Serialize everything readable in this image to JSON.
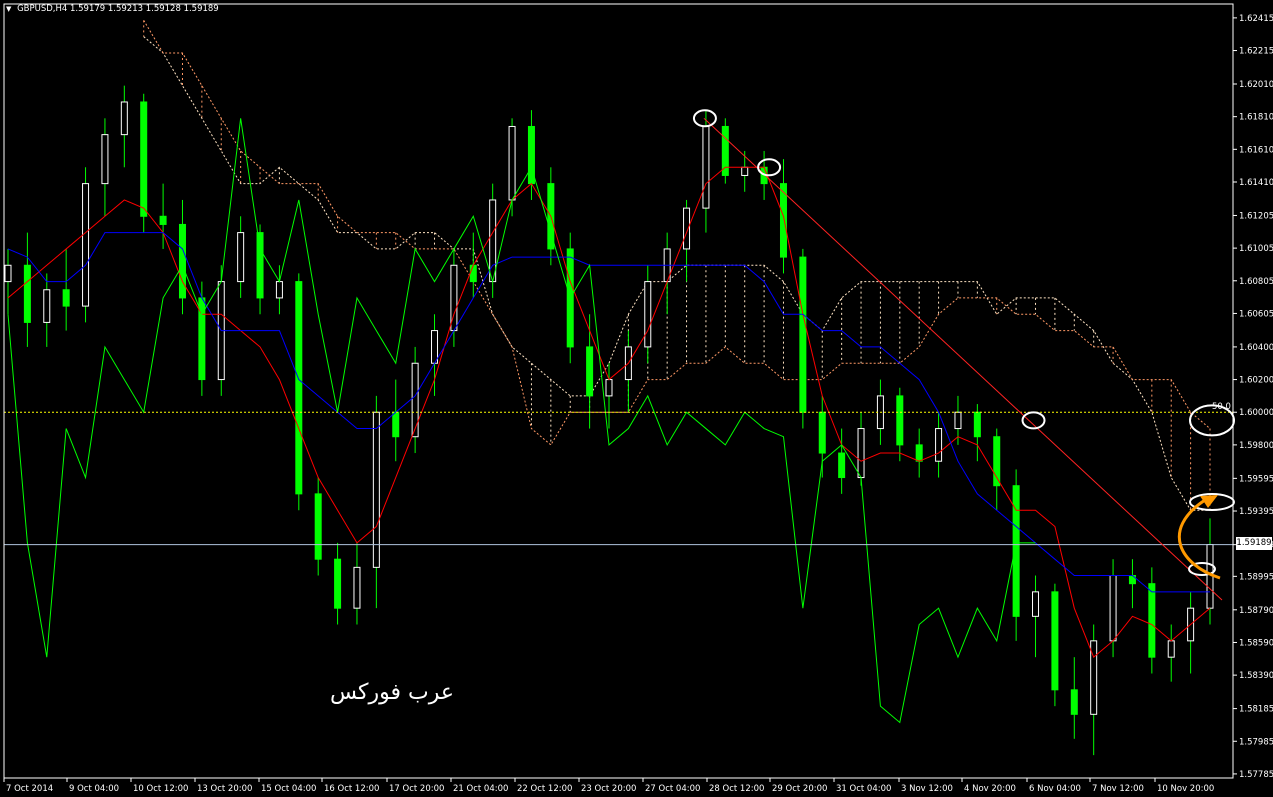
{
  "header": {
    "symbol": "GBPUSD,H4",
    "ohlc": "1.59179 1.59213 1.59128 1.59189"
  },
  "watermark": "عرب فوركس",
  "colors": {
    "background": "#000000",
    "bull_candle": "#ffffff",
    "bear_candle": "#00ff00",
    "tenkan": "#ff0000",
    "kijun": "#0000ff",
    "chikou": "#00ff00",
    "cloud_a": "#ffe4c4",
    "cloud_b": "#ff9966",
    "trendline": "#ff2222",
    "level_line": "#ffff00",
    "bid_line": "#b0c4de",
    "projection": "#ff9900"
  },
  "chart_data": {
    "type": "candlestick",
    "title": "GBPUSD,H4",
    "ylim": [
      1.5776,
      1.625
    ],
    "y_ticks": [
      "1.62415",
      "1.62215",
      "1.62010",
      "1.61810",
      "1.61610",
      "1.61410",
      "1.61205",
      "1.61005",
      "1.60805",
      "1.60605",
      "1.60400",
      "1.60200",
      "1.60000",
      "1.59800",
      "1.59595",
      "1.59395",
      "1.59189",
      "1.58995",
      "1.58790",
      "1.58590",
      "1.58390",
      "1.58185",
      "1.57985",
      "1.57785"
    ],
    "x_ticks": [
      "7 Oct 2014",
      "9 Oct 04:00",
      "10 Oct 12:00",
      "13 Oct 20:00",
      "15 Oct 04:00",
      "16 Oct 12:00",
      "17 Oct 20:00",
      "21 Oct 04:00",
      "22 Oct 12:00",
      "23 Oct 20:00",
      "27 Oct 04:00",
      "28 Oct 12:00",
      "29 Oct 20:00",
      "31 Oct 04:00",
      "3 Nov 12:00",
      "4 Nov 20:00",
      "6 Nov 04:00",
      "7 Nov 12:00",
      "10 Nov 20:00"
    ],
    "current_price": "1.59189",
    "level_line": 1.6,
    "level_label": "50.0",
    "candles": [
      {
        "o": 1.608,
        "h": 1.61,
        "l": 1.606,
        "c": 1.609
      },
      {
        "o": 1.609,
        "h": 1.611,
        "l": 1.604,
        "c": 1.6055
      },
      {
        "o": 1.6055,
        "h": 1.6085,
        "l": 1.604,
        "c": 1.6075
      },
      {
        "o": 1.6075,
        "h": 1.61,
        "l": 1.605,
        "c": 1.6065
      },
      {
        "o": 1.6065,
        "h": 1.615,
        "l": 1.6055,
        "c": 1.614
      },
      {
        "o": 1.614,
        "h": 1.618,
        "l": 1.612,
        "c": 1.617
      },
      {
        "o": 1.617,
        "h": 1.62,
        "l": 1.615,
        "c": 1.619
      },
      {
        "o": 1.619,
        "h": 1.6195,
        "l": 1.611,
        "c": 1.612
      },
      {
        "o": 1.612,
        "h": 1.614,
        "l": 1.61,
        "c": 1.6115
      },
      {
        "o": 1.6115,
        "h": 1.613,
        "l": 1.606,
        "c": 1.607
      },
      {
        "o": 1.607,
        "h": 1.608,
        "l": 1.601,
        "c": 1.602
      },
      {
        "o": 1.602,
        "h": 1.609,
        "l": 1.601,
        "c": 1.608
      },
      {
        "o": 1.608,
        "h": 1.612,
        "l": 1.607,
        "c": 1.611
      },
      {
        "o": 1.611,
        "h": 1.6115,
        "l": 1.606,
        "c": 1.607
      },
      {
        "o": 1.607,
        "h": 1.609,
        "l": 1.606,
        "c": 1.608
      },
      {
        "o": 1.608,
        "h": 1.6085,
        "l": 1.594,
        "c": 1.595
      },
      {
        "o": 1.595,
        "h": 1.596,
        "l": 1.59,
        "c": 1.591
      },
      {
        "o": 1.591,
        "h": 1.592,
        "l": 1.587,
        "c": 1.588
      },
      {
        "o": 1.588,
        "h": 1.592,
        "l": 1.587,
        "c": 1.5905
      },
      {
        "o": 1.5905,
        "h": 1.601,
        "l": 1.588,
        "c": 1.6
      },
      {
        "o": 1.6,
        "h": 1.602,
        "l": 1.597,
        "c": 1.5985
      },
      {
        "o": 1.5985,
        "h": 1.604,
        "l": 1.5975,
        "c": 1.603
      },
      {
        "o": 1.603,
        "h": 1.606,
        "l": 1.601,
        "c": 1.605
      },
      {
        "o": 1.605,
        "h": 1.61,
        "l": 1.604,
        "c": 1.609
      },
      {
        "o": 1.609,
        "h": 1.611,
        "l": 1.607,
        "c": 1.608
      },
      {
        "o": 1.608,
        "h": 1.614,
        "l": 1.607,
        "c": 1.613
      },
      {
        "o": 1.613,
        "h": 1.618,
        "l": 1.612,
        "c": 1.6175
      },
      {
        "o": 1.6175,
        "h": 1.6185,
        "l": 1.613,
        "c": 1.614
      },
      {
        "o": 1.614,
        "h": 1.615,
        "l": 1.609,
        "c": 1.61
      },
      {
        "o": 1.61,
        "h": 1.611,
        "l": 1.603,
        "c": 1.604
      },
      {
        "o": 1.604,
        "h": 1.606,
        "l": 1.599,
        "c": 1.601
      },
      {
        "o": 1.601,
        "h": 1.603,
        "l": 1.599,
        "c": 1.602
      },
      {
        "o": 1.602,
        "h": 1.605,
        "l": 1.6,
        "c": 1.604
      },
      {
        "o": 1.604,
        "h": 1.609,
        "l": 1.603,
        "c": 1.608
      },
      {
        "o": 1.608,
        "h": 1.611,
        "l": 1.606,
        "c": 1.61
      },
      {
        "o": 1.61,
        "h": 1.613,
        "l": 1.608,
        "c": 1.6125
      },
      {
        "o": 1.6125,
        "h": 1.6185,
        "l": 1.611,
        "c": 1.6175
      },
      {
        "o": 1.6175,
        "h": 1.618,
        "l": 1.614,
        "c": 1.6145
      },
      {
        "o": 1.6145,
        "h": 1.616,
        "l": 1.6135,
        "c": 1.615
      },
      {
        "o": 1.615,
        "h": 1.616,
        "l": 1.613,
        "c": 1.614
      },
      {
        "o": 1.614,
        "h": 1.6155,
        "l": 1.6085,
        "c": 1.6095
      },
      {
        "o": 1.6095,
        "h": 1.61,
        "l": 1.599,
        "c": 1.6
      },
      {
        "o": 1.6,
        "h": 1.601,
        "l": 1.596,
        "c": 1.5975
      },
      {
        "o": 1.5975,
        "h": 1.599,
        "l": 1.595,
        "c": 1.596
      },
      {
        "o": 1.596,
        "h": 1.6,
        "l": 1.5955,
        "c": 1.599
      },
      {
        "o": 1.599,
        "h": 1.602,
        "l": 1.598,
        "c": 1.601
      },
      {
        "o": 1.601,
        "h": 1.6015,
        "l": 1.597,
        "c": 1.598
      },
      {
        "o": 1.598,
        "h": 1.599,
        "l": 1.596,
        "c": 1.597
      },
      {
        "o": 1.597,
        "h": 1.6,
        "l": 1.596,
        "c": 1.599
      },
      {
        "o": 1.599,
        "h": 1.601,
        "l": 1.598,
        "c": 1.6
      },
      {
        "o": 1.6,
        "h": 1.6005,
        "l": 1.597,
        "c": 1.5985
      },
      {
        "o": 1.5985,
        "h": 1.599,
        "l": 1.594,
        "c": 1.5955
      },
      {
        "o": 1.5955,
        "h": 1.5965,
        "l": 1.586,
        "c": 1.5875
      },
      {
        "o": 1.5875,
        "h": 1.59,
        "l": 1.585,
        "c": 1.589
      },
      {
        "o": 1.589,
        "h": 1.5895,
        "l": 1.582,
        "c": 1.583
      },
      {
        "o": 1.583,
        "h": 1.585,
        "l": 1.58,
        "c": 1.5815
      },
      {
        "o": 1.5815,
        "h": 1.587,
        "l": 1.579,
        "c": 1.586
      },
      {
        "o": 1.586,
        "h": 1.591,
        "l": 1.585,
        "c": 1.59
      },
      {
        "o": 1.59,
        "h": 1.591,
        "l": 1.588,
        "c": 1.5895
      },
      {
        "o": 1.5895,
        "h": 1.5905,
        "l": 1.584,
        "c": 1.585
      },
      {
        "o": 1.585,
        "h": 1.587,
        "l": 1.5835,
        "c": 1.586
      },
      {
        "o": 1.586,
        "h": 1.589,
        "l": 1.584,
        "c": 1.588
      },
      {
        "o": 1.588,
        "h": 1.5935,
        "l": 1.587,
        "c": 1.5919
      }
    ],
    "series": [
      {
        "name": "Tenkan-sen",
        "values": [
          1.607,
          1.608,
          1.609,
          1.61,
          1.611,
          1.612,
          1.613,
          1.6125,
          1.611,
          1.608,
          1.606,
          1.606,
          1.605,
          1.604,
          1.602,
          1.599,
          1.596,
          1.594,
          1.592,
          1.593,
          1.596,
          1.599,
          1.602,
          1.606,
          1.609,
          1.611,
          1.613,
          1.614,
          1.612,
          1.608,
          1.605,
          1.602,
          1.603,
          1.605,
          1.608,
          1.611,
          1.614,
          1.615,
          1.615,
          1.615,
          1.612,
          1.606,
          1.601,
          1.598,
          1.597,
          1.5975,
          1.5975,
          1.597,
          1.5975,
          1.5985,
          1.598,
          1.596,
          1.594,
          1.594,
          1.593,
          1.588,
          1.585,
          1.586,
          1.5875,
          1.587,
          1.586,
          1.587,
          1.588
        ]
      },
      {
        "name": "Kijun-sen",
        "values": [
          1.61,
          1.6095,
          1.608,
          1.608,
          1.609,
          1.611,
          1.611,
          1.611,
          1.611,
          1.61,
          1.607,
          1.605,
          1.605,
          1.605,
          1.605,
          1.602,
          1.601,
          1.6,
          1.599,
          1.599,
          1.6,
          1.601,
          1.603,
          1.605,
          1.607,
          1.609,
          1.6095,
          1.6095,
          1.6095,
          1.6095,
          1.609,
          1.609,
          1.609,
          1.609,
          1.609,
          1.609,
          1.609,
          1.609,
          1.609,
          1.608,
          1.606,
          1.606,
          1.605,
          1.605,
          1.604,
          1.604,
          1.603,
          1.602,
          1.6,
          1.597,
          1.595,
          1.594,
          1.593,
          1.592,
          1.591,
          1.59,
          1.59,
          1.59,
          1.59,
          1.589,
          1.589,
          1.589,
          1.589
        ]
      },
      {
        "name": "Chikou Span",
        "values": [
          1.606,
          1.592,
          1.585,
          1.599,
          1.596,
          1.604,
          1.602,
          1.6,
          1.607,
          1.609,
          1.606,
          1.608,
          1.618,
          1.61,
          1.608,
          1.613,
          1.606,
          1.6,
          1.607,
          1.605,
          1.603,
          1.61,
          1.608,
          1.61,
          1.612,
          1.608,
          1.613,
          1.615,
          1.611,
          1.607,
          1.609,
          1.598,
          1.599,
          1.601,
          1.598,
          1.6,
          1.599,
          1.598,
          1.6,
          1.599,
          1.5985,
          1.588,
          1.597,
          1.598,
          1.596,
          1.582,
          1.581,
          1.587,
          1.588,
          1.585,
          1.588,
          1.586,
          1.592,
          1.592
        ]
      }
    ],
    "cloud": {
      "span_a": [
        1.623,
        1.622,
        1.62,
        1.618,
        1.616,
        1.614,
        1.614,
        1.615,
        1.614,
        1.613,
        1.611,
        1.611,
        1.61,
        1.61,
        1.611,
        1.611,
        1.61,
        1.61,
        1.606,
        1.604,
        1.603,
        1.602,
        1.601,
        1.601,
        1.603,
        1.606,
        1.608,
        1.608,
        1.609,
        1.609,
        1.609,
        1.609,
        1.609,
        1.608,
        1.606,
        1.605,
        1.607,
        1.608,
        1.608,
        1.608,
        1.608,
        1.608,
        1.608,
        1.608,
        1.606,
        1.607,
        1.607,
        1.607,
        1.606,
        1.605,
        1.603,
        1.602,
        1.6,
        1.596,
        1.594,
        1.594
      ],
      "span_b": [
        1.624,
        1.622,
        1.622,
        1.62,
        1.618,
        1.616,
        1.615,
        1.614,
        1.614,
        1.614,
        1.612,
        1.611,
        1.611,
        1.611,
        1.61,
        1.61,
        1.61,
        1.608,
        1.606,
        1.604,
        1.599,
        1.598,
        1.6,
        1.6,
        1.6,
        1.6,
        1.602,
        1.602,
        1.603,
        1.603,
        1.604,
        1.603,
        1.603,
        1.602,
        1.602,
        1.602,
        1.603,
        1.603,
        1.603,
        1.603,
        1.604,
        1.606,
        1.607,
        1.607,
        1.607,
        1.606,
        1.606,
        1.605,
        1.605,
        1.604,
        1.604,
        1.602,
        1.602,
        1.602,
        1.6,
        1.599
      ]
    },
    "trendline": {
      "from": 1.618,
      "to": 1.5885
    },
    "annotations": [
      "swing-high-marker",
      "swing-high-marker",
      "swing-high-marker",
      "level-marker",
      "level-marker",
      "price-marker",
      "projection-arrow"
    ]
  }
}
